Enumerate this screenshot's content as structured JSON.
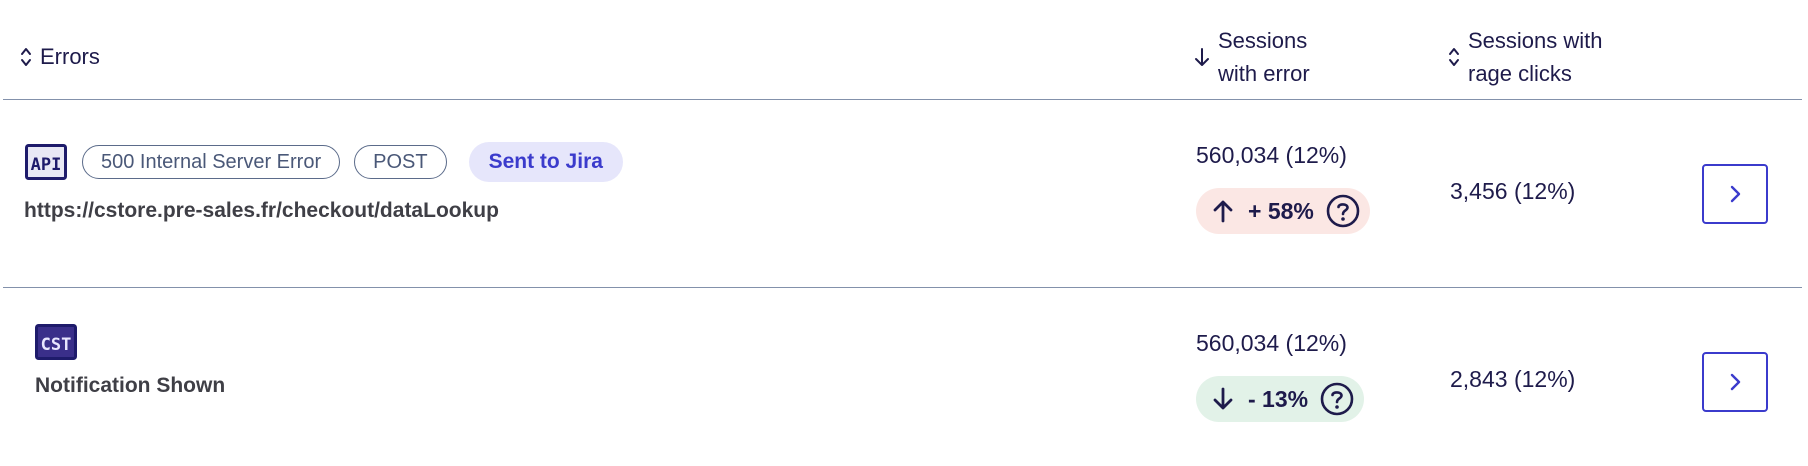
{
  "header": {
    "errors_label": "Errors",
    "sessions_with_error_label": "Sessions\nwith error",
    "sessions_rage_label": "Sessions with\nrage clicks"
  },
  "rows": [
    {
      "icon": "api-icon",
      "icon_text": "API",
      "tags": [
        "500 Internal Server Error",
        "POST"
      ],
      "status": "Sent to Jira",
      "title": "https://cstore.pre-sales.fr/checkout/dataLookup",
      "sessions": "560,034 (12%)",
      "trend_direction": "up",
      "trend": "+ 58%",
      "rage": "3,456 (12%)"
    },
    {
      "icon": "cst-icon",
      "icon_text": "CST",
      "title": "Notification Shown",
      "sessions": "560,034 (12%)",
      "trend_direction": "down",
      "trend": "- 13%",
      "rage": "2,843 (12%)"
    }
  ],
  "colors": {
    "accent": "#3b3bcc",
    "text": "#1e1b4b",
    "trend_up_bg": "#fbe7e4",
    "trend_down_bg": "#e2f2e8",
    "jira_bg": "#e6e6fb",
    "divider": "#8391ab"
  }
}
